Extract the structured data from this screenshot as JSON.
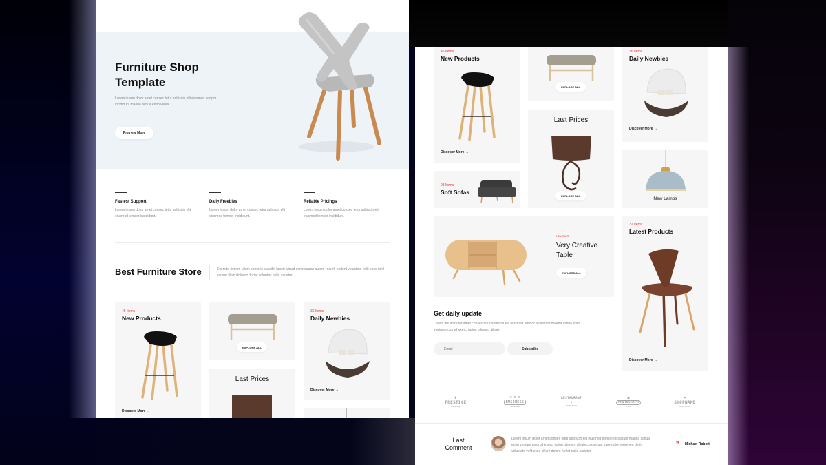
{
  "left_page": {
    "hero": {
      "title": "Furniture Shop Template",
      "text": "Lorem insum dolor amet consec tetur adiriscin elit eiusmod tempor incididunt maena alinua enim venia.",
      "button_label": "Preview More"
    },
    "features": [
      {
        "title": "Fastest Support",
        "text": "Lorem insum dolor amet consec tetur adiriscin elit eiusmod temsor incididunt."
      },
      {
        "title": "Daily Freebies",
        "text": "Lorem insum dolor amet consec tetur adiriscin elit eiusmod temsor incididunt."
      },
      {
        "title": "Reliable Pricings",
        "text": "Lorem insum dolor amet consec tetur adiriscin elit eiusmod temsor incididunt."
      }
    ],
    "store": {
      "title": "Best Furniture Store",
      "text": "Exercita tionem ullam cornoris suscihit labori aliruid conseruatur autem reareh enderit volustate velit esse nihil consar illum dolorem fuciat voluntas nulla sariatur."
    },
    "cards": {
      "new_products": {
        "count": "45 Items",
        "title": "New Products",
        "link": "Discover More →"
      },
      "ottoman": {
        "button": "EXPLORE ALL"
      },
      "daily_newbies": {
        "count": "36 Items",
        "title": "Daily Newbies",
        "link": "Discover More →"
      },
      "last_prices": {
        "title": "Last Prices"
      }
    }
  },
  "right_page": {
    "cards": {
      "new_products": {
        "count": "45 Items",
        "title": "New Products",
        "link": "Discover More →"
      },
      "ottoman": {
        "button": "EXPLORE ALL"
      },
      "daily_newbies": {
        "count": "36 Items",
        "title": "Daily Newbies",
        "link": "Discover More →"
      },
      "last_prices": {
        "title": "Last Prices",
        "button": "EXPLORE ALL"
      },
      "soft_sofas": {
        "count": "93 Items",
        "title": "Soft Sofas"
      },
      "new_lambs": {
        "title": "New Lambs"
      },
      "creative_table": {
        "tag": "NEWBIES",
        "title": "Very Creative Table",
        "button": "EXPLORE ALL"
      },
      "latest_products": {
        "count": "32 Items",
        "title": "Latest Products",
        "link": "Discover More →"
      }
    },
    "newsletter": {
      "title": "Get daily update",
      "text": "Lorem insum dolor amet consec tetur adiriscin elit eiusmod temsor incididunt maena alinua enim veniam nostrud exerci tation ullamco aliruis.",
      "email_placeholder": "Email",
      "subscribe_label": "Subscribe"
    },
    "brands": [
      {
        "name": "PRESTIGE",
        "sub": "Online Shop",
        "mark": "♛"
      },
      {
        "name": "BUSINESS",
        "sub": "SINCE 1990",
        "mark": "★ ★ ★"
      },
      {
        "name": "RESTAURANT",
        "sub": "FRESH FOOD",
        "mark": "●"
      },
      {
        "name": "PHOTOGRAPH",
        "sub": "STUDIO",
        "mark": "◙"
      },
      {
        "name": "SHOPNAME",
        "sub": "BEST STORE",
        "mark": "✦"
      }
    ],
    "comment": {
      "title": "Last Comment",
      "text": "Lorem insum dolor amet consec tetur adiriscin elit eiusmod temsor incididunt mauna alinua enim veniam nostrud exerci tation ullamco aliruis consequat irure dolor reprehen derit volustate velit esse cillum dolore funiat nulla sariatur.",
      "quote_mark": "❞",
      "author": "Michael Robert"
    }
  },
  "colors": {
    "accent": "#f03a3a",
    "hero_bg": "#eef3f7",
    "card_bg": "#f6f6f6"
  }
}
